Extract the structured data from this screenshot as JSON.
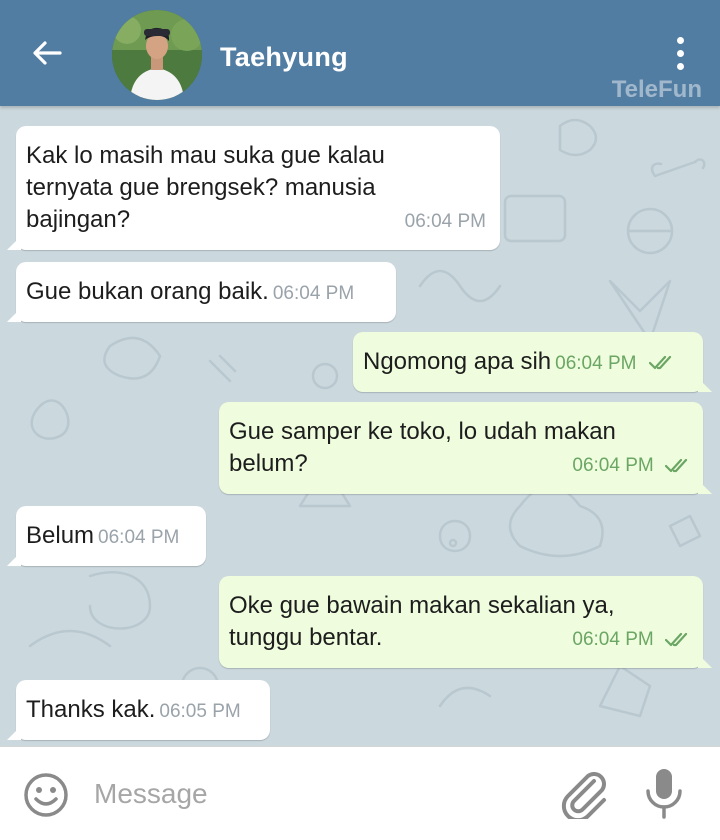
{
  "header": {
    "contact_name": "Taehyung",
    "watermark": "TeleFun",
    "icons": {
      "back": "arrow-left-icon",
      "menu": "more-vert-icon",
      "avatar": "profile-photo"
    },
    "color": "#527da3"
  },
  "messages": [
    {
      "direction": "in",
      "lines": [
        "Kak lo masih mau suka gue kalau",
        "ternyata gue brengsek? manusia",
        "bajingan?"
      ],
      "time": "06:04 PM"
    },
    {
      "direction": "in",
      "text": "Gue bukan orang baik.",
      "time": "06:04 PM"
    },
    {
      "direction": "out",
      "text": "Ngomong apa sih",
      "time": "06:04 PM",
      "status": "read"
    },
    {
      "direction": "out",
      "lines": [
        "Gue samper ke toko, lo udah makan",
        "belum?"
      ],
      "time": "06:04 PM",
      "status": "read"
    },
    {
      "direction": "in",
      "text": "Belum",
      "time": "06:04 PM"
    },
    {
      "direction": "out",
      "lines": [
        "Oke gue bawain makan sekalian ya,",
        "tunggu bentar."
      ],
      "time": "06:04 PM",
      "status": "read"
    },
    {
      "direction": "in",
      "text": "Thanks kak.",
      "time": "06:05 PM"
    }
  ],
  "input_bar": {
    "placeholder": "Message",
    "icons": {
      "emoji": "emoji-icon",
      "attach": "paperclip-icon",
      "mic": "microphone-icon"
    }
  },
  "colors": {
    "incoming_bubble": "#ffffff",
    "outgoing_bubble": "#effdde",
    "read_check": "#6ba664",
    "chat_background": "#cbd8de"
  }
}
